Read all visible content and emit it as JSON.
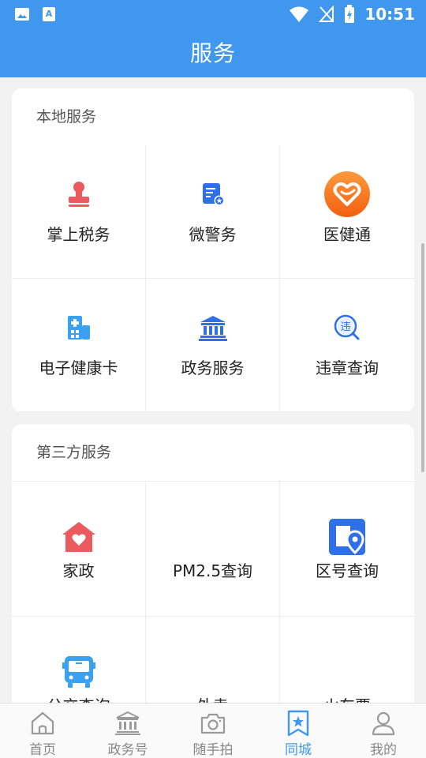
{
  "status_bar": {
    "time": "10:51"
  },
  "header": {
    "title": "服务"
  },
  "sections": [
    {
      "title": "本地服务",
      "items": [
        {
          "label": "掌上税务",
          "icon": "stamp-icon"
        },
        {
          "label": "微警务",
          "icon": "police-doc-icon"
        },
        {
          "label": "医健通",
          "icon": "heart-app-icon"
        },
        {
          "label": "电子健康卡",
          "icon": "hospital-icon"
        },
        {
          "label": "政务服务",
          "icon": "government-icon"
        },
        {
          "label": "违章查询",
          "icon": "violation-search-icon"
        }
      ]
    },
    {
      "title": "第三方服务",
      "items": [
        {
          "label": "家政",
          "icon": "home-heart-icon"
        },
        {
          "label": "PM2.5查询",
          "icon": ""
        },
        {
          "label": "区号查询",
          "icon": "area-code-icon"
        },
        {
          "label": "公交查询",
          "icon": "bus-icon"
        },
        {
          "label": "外卖",
          "icon": ""
        },
        {
          "label": "火车票",
          "icon": ""
        }
      ]
    }
  ],
  "bottom_nav": [
    {
      "label": "首页",
      "icon": "home-icon"
    },
    {
      "label": "政务号",
      "icon": "government-icon"
    },
    {
      "label": "随手拍",
      "icon": "camera-icon"
    },
    {
      "label": "同城",
      "icon": "bookmark-star-icon",
      "active": true
    },
    {
      "label": "我的",
      "icon": "user-icon"
    }
  ],
  "colors": {
    "primary": "#3f98ee",
    "red": "#ea5a5f",
    "orange": "#f57c1f",
    "blue_icon": "#2f6fe8"
  }
}
